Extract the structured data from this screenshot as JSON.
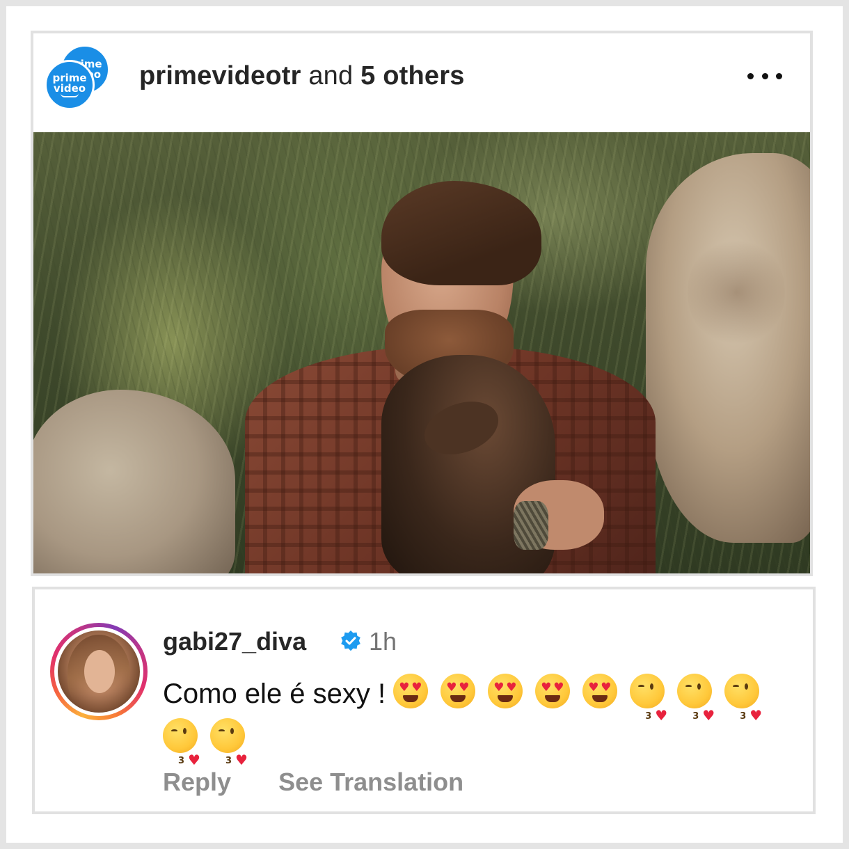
{
  "post": {
    "avatar_text_line1": "prime",
    "avatar_text_line2": "video",
    "author": "primevideotr",
    "author_suffix": " and ",
    "others": "5 others",
    "more_icon": "more-horizontal-icon"
  },
  "comment": {
    "username": "gabi27_diva",
    "verified_icon": "verified-badge-icon",
    "time": "1h",
    "text": "Como ele é sexy !",
    "emojis": [
      "heart-eyes",
      "heart-eyes",
      "heart-eyes",
      "heart-eyes",
      "heart-eyes",
      "kissing-heart",
      "kissing-heart",
      "kissing-heart",
      "kissing-heart",
      "kissing-heart"
    ],
    "reply_label": "Reply",
    "translate_label": "See Translation"
  },
  "colors": {
    "prime_blue": "#1a8ee6",
    "verified_blue": "#1d9bf0",
    "muted_text": "#8e8e8e"
  }
}
